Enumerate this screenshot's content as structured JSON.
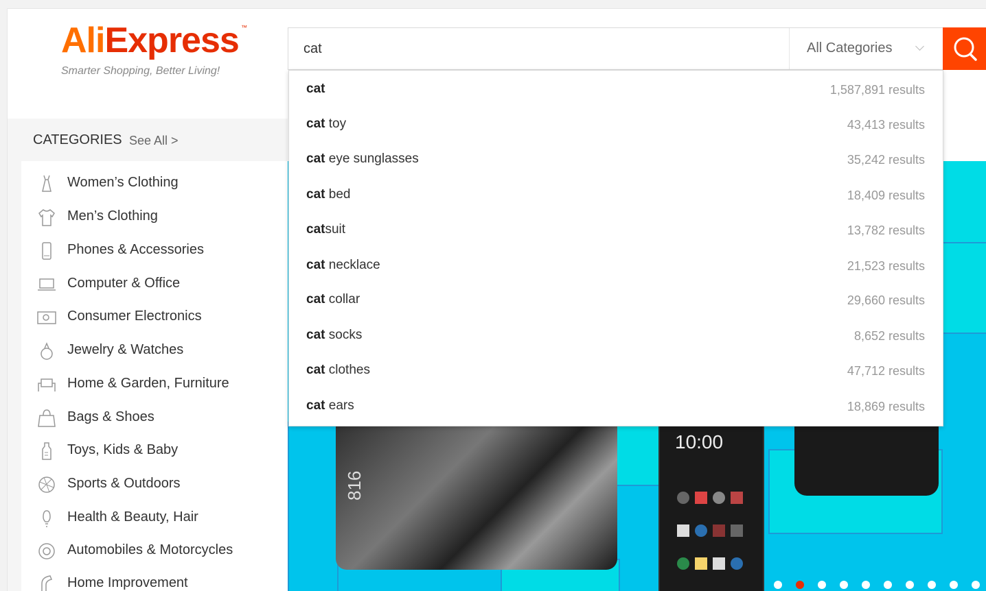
{
  "logo": {
    "part1": "Ali",
    "part2": "Express",
    "tm": "™",
    "tagline": "Smarter Shopping, Better Living!"
  },
  "search": {
    "value": "cat",
    "category": "All Categories",
    "icon": "search-icon"
  },
  "suggestions": [
    {
      "bold": "cat",
      "rest": "",
      "count": "1,587,891 results"
    },
    {
      "bold": "cat",
      "rest": " toy",
      "count": "43,413 results"
    },
    {
      "bold": "cat",
      "rest": " eye sunglasses",
      "count": "35,242 results"
    },
    {
      "bold": "cat",
      "rest": " bed",
      "count": "18,409 results"
    },
    {
      "bold": "cat",
      "rest": "suit",
      "count": "13,782 results"
    },
    {
      "bold": "cat",
      "rest": " necklace",
      "count": "21,523 results"
    },
    {
      "bold": "cat",
      "rest": " collar",
      "count": "29,660 results"
    },
    {
      "bold": "cat",
      "rest": " socks",
      "count": "8,652 results"
    },
    {
      "bold": "cat",
      "rest": " clothes",
      "count": "47,712 results"
    },
    {
      "bold": "cat",
      "rest": " ears",
      "count": "18,869 results"
    }
  ],
  "categories": {
    "title": "CATEGORIES",
    "see_all": "See All >",
    "items": [
      {
        "label": "Women’s Clothing",
        "icon": "dress-icon"
      },
      {
        "label": "Men’s Clothing",
        "icon": "shirt-icon"
      },
      {
        "label": "Phones & Accessories",
        "icon": "phone-icon"
      },
      {
        "label": "Computer & Office",
        "icon": "laptop-icon"
      },
      {
        "label": "Consumer Electronics",
        "icon": "camera-icon"
      },
      {
        "label": "Jewelry & Watches",
        "icon": "ring-icon"
      },
      {
        "label": "Home & Garden, Furniture",
        "icon": "sofa-icon"
      },
      {
        "label": "Bags & Shoes",
        "icon": "bag-icon"
      },
      {
        "label": "Toys, Kids & Baby",
        "icon": "bottle-icon"
      },
      {
        "label": "Sports & Outdoors",
        "icon": "ball-icon"
      },
      {
        "label": "Health & Beauty, Hair",
        "icon": "bulb-icon"
      },
      {
        "label": "Automobiles & Motorcycles",
        "icon": "wheel-icon"
      },
      {
        "label": "Home Improvement",
        "icon": "tool-icon"
      }
    ]
  },
  "banner": {
    "clock_text": "10:00",
    "phone_side_text": "816",
    "dot_count": 10,
    "active_dot": 1
  },
  "colors": {
    "brand_orange": "#ff6f00",
    "brand_red": "#e62e04",
    "search_button": "#ff4400",
    "banner_bg": "#00c4ec"
  }
}
